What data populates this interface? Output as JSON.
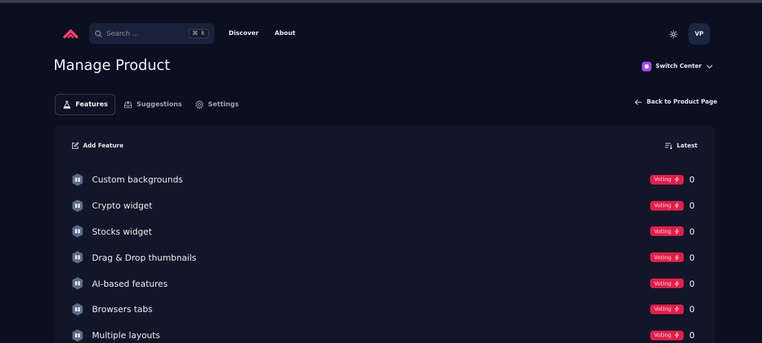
{
  "header": {
    "search_placeholder": "Search ...",
    "search_shortcut": "⌘ k",
    "nav": [
      {
        "label": "Discover"
      },
      {
        "label": "About"
      }
    ],
    "avatar_initials": "VP"
  },
  "page": {
    "title": "Manage Product",
    "switch_center_label": "Switch Center",
    "back_link_label": "Back to Product Page"
  },
  "tabs": [
    {
      "label": "Features",
      "active": true
    },
    {
      "label": "Suggestions",
      "active": false
    },
    {
      "label": "Settings",
      "active": false
    }
  ],
  "panel": {
    "add_feature_label": "Add Feature",
    "sort_label": "Latest",
    "features": [
      {
        "name": "Custom backgrounds",
        "status": "Voting",
        "votes": "0"
      },
      {
        "name": "Crypto widget",
        "status": "Voting",
        "votes": "0"
      },
      {
        "name": "Stocks widget",
        "status": "Voting",
        "votes": "0"
      },
      {
        "name": "Drag & Drop thumbnails",
        "status": "Voting",
        "votes": "0"
      },
      {
        "name": "AI-based features",
        "status": "Voting",
        "votes": "0"
      },
      {
        "name": "Browsers tabs",
        "status": "Voting",
        "votes": "0"
      },
      {
        "name": "Multiple layouts",
        "status": "Voting",
        "votes": "0"
      }
    ]
  },
  "colors": {
    "background": "#0b1020",
    "panel": "#111729",
    "accent_logo": "#ff3d6b",
    "badge_voting": "#e51d48",
    "switch_icon": "#9b4dff"
  },
  "icons": {
    "logo": "chevron-up-logo",
    "search": "search-icon",
    "theme": "sun-icon",
    "feature_item": "hexagon-book-icon",
    "badge": "lightning-icon"
  }
}
